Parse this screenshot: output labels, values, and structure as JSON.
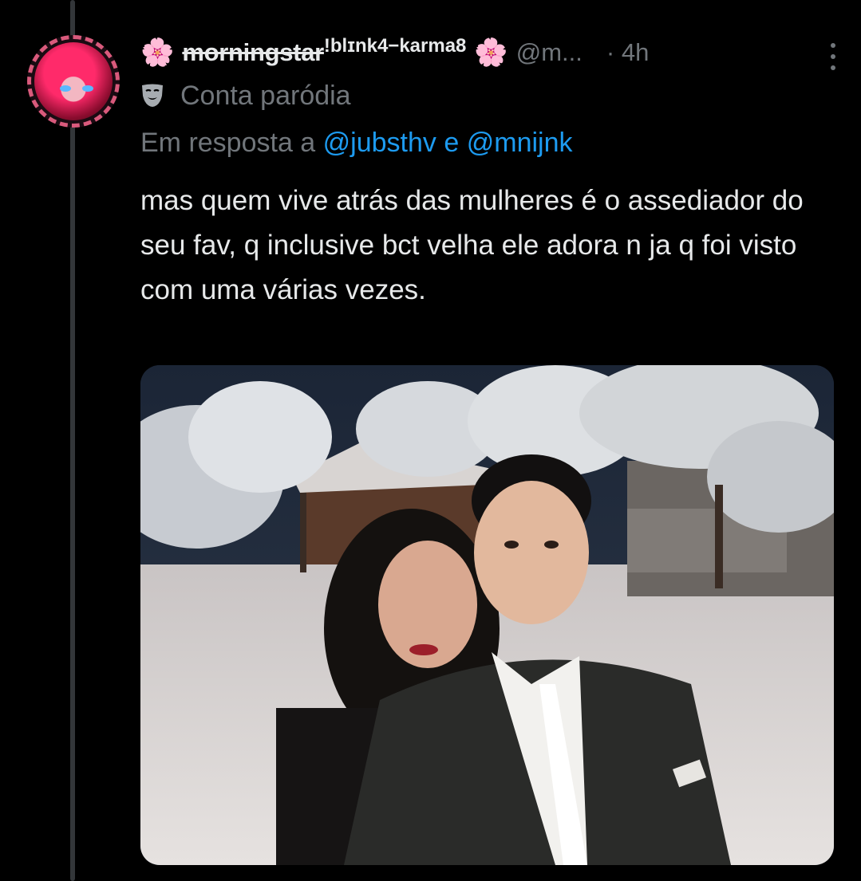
{
  "tweet": {
    "display_name": "morningstar",
    "display_name_suffix": "!blɪnk4−karma8",
    "emoji_left": "🌸",
    "emoji_right": "🌸",
    "handle": "@m...",
    "time": "· 4h",
    "parody_label": "Conta paródia",
    "reply_prefix": "Em resposta a",
    "mention_1": "@jubsthv",
    "reply_connector": "e",
    "mention_2": "@mnijnk",
    "text": "mas quem vive atrás das mulheres é o assediador do seu fav, q inclusive bct velha ele adora n ja q foi visto com uma várias vezes."
  },
  "icons": {
    "more": "more-vertical-icon",
    "parody": "theater-mask-icon",
    "emoji": "cherry-blossom-icon"
  },
  "colors": {
    "background": "#000000",
    "text": "#e7e9ea",
    "muted": "#71767b",
    "link": "#1d9bf0",
    "thread_line": "#333639"
  }
}
